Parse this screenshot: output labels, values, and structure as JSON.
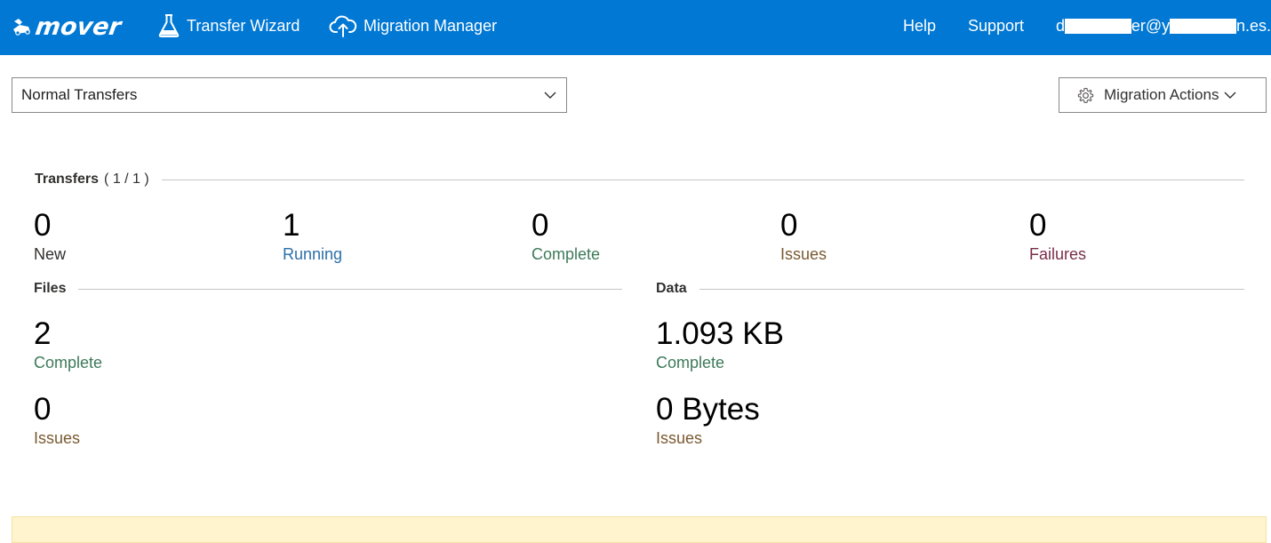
{
  "header": {
    "brand": "mover",
    "nav": {
      "transfer_wizard": "Transfer Wizard",
      "migration_manager": "Migration Manager",
      "help": "Help",
      "support": "Support",
      "user_email_fragments": [
        "d",
        "er@y",
        "n.es."
      ]
    }
  },
  "toolbar": {
    "view_select": {
      "value": "Normal Transfers"
    },
    "migration_actions_label": "Migration Actions"
  },
  "transfers": {
    "title": "Transfers",
    "count": "( 1 / 1 )",
    "stats": [
      {
        "value": "0",
        "label": "New"
      },
      {
        "value": "1",
        "label": "Running"
      },
      {
        "value": "0",
        "label": "Complete"
      },
      {
        "value": "0",
        "label": "Issues"
      },
      {
        "value": "0",
        "label": "Failures"
      }
    ]
  },
  "files": {
    "title": "Files",
    "complete": {
      "value": "2",
      "label": "Complete"
    },
    "issues": {
      "value": "0",
      "label": "Issues"
    }
  },
  "data": {
    "title": "Data",
    "complete": {
      "value": "1.093 KB",
      "label": "Complete"
    },
    "issues": {
      "value": "0 Bytes",
      "label": "Issues"
    }
  },
  "colors": {
    "topbar": "#0078d4",
    "running": "#2b6fa8",
    "complete": "#3d7a5a",
    "issues": "#7a5a32",
    "failures": "#7a2e4a",
    "banner": "#fff4ce"
  },
  "icons": {
    "logo": "mover-mascot-icon",
    "transfer_wizard": "flask-icon",
    "migration_manager": "cloud-upload-icon",
    "select": "chevron-down-icon",
    "actions": "gear-icon"
  }
}
